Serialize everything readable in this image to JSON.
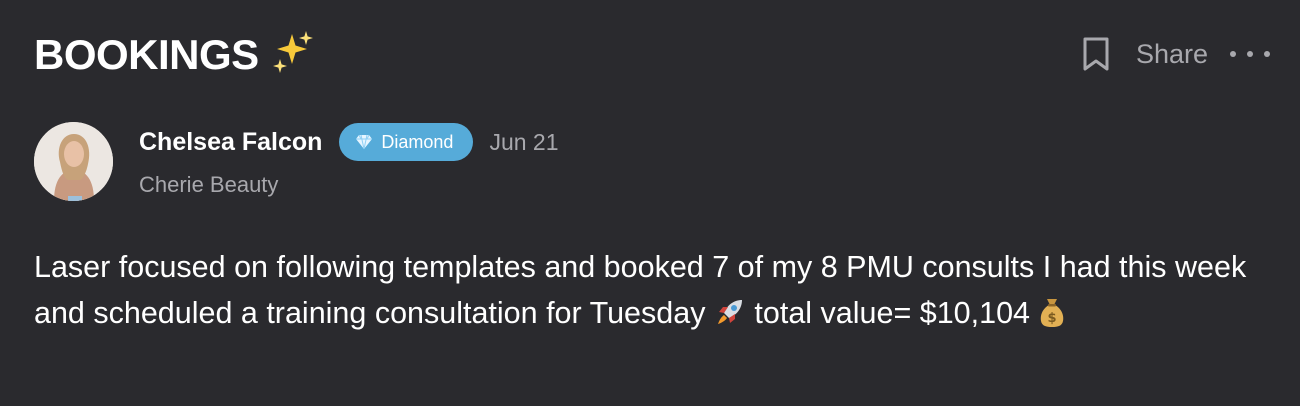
{
  "header": {
    "title": "BOOKINGS",
    "title_icon": "sparkles-icon",
    "share_label": "Share",
    "bookmark_icon": "bookmark-icon",
    "more_icon": "more-horizontal-icon"
  },
  "post": {
    "author": {
      "name": "Chelsea Falcon",
      "company": "Cherie Beauty",
      "badge_label": "Diamond",
      "badge_icon": "diamond-icon",
      "badge_color": "#56abd9"
    },
    "date": "Jun 21",
    "body": {
      "part1": "Laser focused on following templates and booked 7 of my 8 PMU consults I had this week and scheduled a training consultation for Tuesday",
      "emoji1": "rocket-icon",
      "part2": "total value= $10,104",
      "emoji2": "money-bag-icon"
    }
  },
  "colors": {
    "background": "#2a2a2e",
    "text_primary": "#ffffff",
    "text_secondary": "#a8a8ad",
    "accent": "#56abd9"
  }
}
